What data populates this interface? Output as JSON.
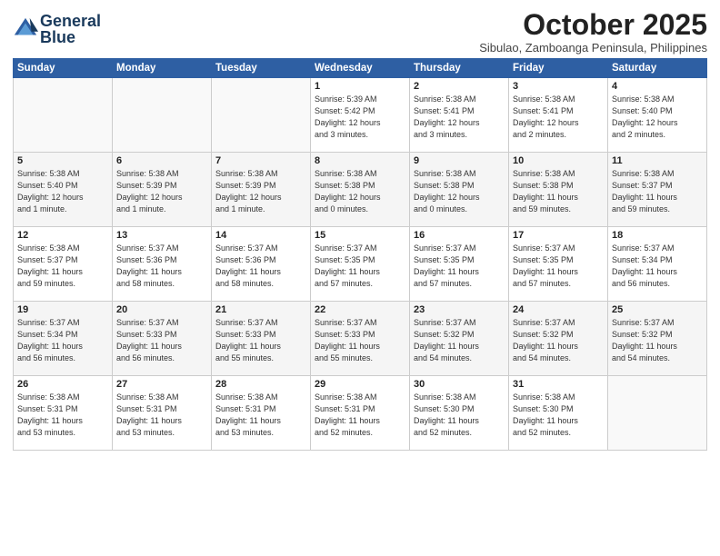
{
  "logo": {
    "line1": "General",
    "line2": "Blue"
  },
  "title": "October 2025",
  "subtitle": "Sibulao, Zamboanga Peninsula, Philippines",
  "days_of_week": [
    "Sunday",
    "Monday",
    "Tuesday",
    "Wednesday",
    "Thursday",
    "Friday",
    "Saturday"
  ],
  "weeks": [
    [
      {
        "day": "",
        "info": ""
      },
      {
        "day": "",
        "info": ""
      },
      {
        "day": "",
        "info": ""
      },
      {
        "day": "1",
        "info": "Sunrise: 5:39 AM\nSunset: 5:42 PM\nDaylight: 12 hours\nand 3 minutes."
      },
      {
        "day": "2",
        "info": "Sunrise: 5:38 AM\nSunset: 5:41 PM\nDaylight: 12 hours\nand 3 minutes."
      },
      {
        "day": "3",
        "info": "Sunrise: 5:38 AM\nSunset: 5:41 PM\nDaylight: 12 hours\nand 2 minutes."
      },
      {
        "day": "4",
        "info": "Sunrise: 5:38 AM\nSunset: 5:40 PM\nDaylight: 12 hours\nand 2 minutes."
      }
    ],
    [
      {
        "day": "5",
        "info": "Sunrise: 5:38 AM\nSunset: 5:40 PM\nDaylight: 12 hours\nand 1 minute."
      },
      {
        "day": "6",
        "info": "Sunrise: 5:38 AM\nSunset: 5:39 PM\nDaylight: 12 hours\nand 1 minute."
      },
      {
        "day": "7",
        "info": "Sunrise: 5:38 AM\nSunset: 5:39 PM\nDaylight: 12 hours\nand 1 minute."
      },
      {
        "day": "8",
        "info": "Sunrise: 5:38 AM\nSunset: 5:38 PM\nDaylight: 12 hours\nand 0 minutes."
      },
      {
        "day": "9",
        "info": "Sunrise: 5:38 AM\nSunset: 5:38 PM\nDaylight: 12 hours\nand 0 minutes."
      },
      {
        "day": "10",
        "info": "Sunrise: 5:38 AM\nSunset: 5:38 PM\nDaylight: 11 hours\nand 59 minutes."
      },
      {
        "day": "11",
        "info": "Sunrise: 5:38 AM\nSunset: 5:37 PM\nDaylight: 11 hours\nand 59 minutes."
      }
    ],
    [
      {
        "day": "12",
        "info": "Sunrise: 5:38 AM\nSunset: 5:37 PM\nDaylight: 11 hours\nand 59 minutes."
      },
      {
        "day": "13",
        "info": "Sunrise: 5:37 AM\nSunset: 5:36 PM\nDaylight: 11 hours\nand 58 minutes."
      },
      {
        "day": "14",
        "info": "Sunrise: 5:37 AM\nSunset: 5:36 PM\nDaylight: 11 hours\nand 58 minutes."
      },
      {
        "day": "15",
        "info": "Sunrise: 5:37 AM\nSunset: 5:35 PM\nDaylight: 11 hours\nand 57 minutes."
      },
      {
        "day": "16",
        "info": "Sunrise: 5:37 AM\nSunset: 5:35 PM\nDaylight: 11 hours\nand 57 minutes."
      },
      {
        "day": "17",
        "info": "Sunrise: 5:37 AM\nSunset: 5:35 PM\nDaylight: 11 hours\nand 57 minutes."
      },
      {
        "day": "18",
        "info": "Sunrise: 5:37 AM\nSunset: 5:34 PM\nDaylight: 11 hours\nand 56 minutes."
      }
    ],
    [
      {
        "day": "19",
        "info": "Sunrise: 5:37 AM\nSunset: 5:34 PM\nDaylight: 11 hours\nand 56 minutes."
      },
      {
        "day": "20",
        "info": "Sunrise: 5:37 AM\nSunset: 5:33 PM\nDaylight: 11 hours\nand 56 minutes."
      },
      {
        "day": "21",
        "info": "Sunrise: 5:37 AM\nSunset: 5:33 PM\nDaylight: 11 hours\nand 55 minutes."
      },
      {
        "day": "22",
        "info": "Sunrise: 5:37 AM\nSunset: 5:33 PM\nDaylight: 11 hours\nand 55 minutes."
      },
      {
        "day": "23",
        "info": "Sunrise: 5:37 AM\nSunset: 5:32 PM\nDaylight: 11 hours\nand 54 minutes."
      },
      {
        "day": "24",
        "info": "Sunrise: 5:37 AM\nSunset: 5:32 PM\nDaylight: 11 hours\nand 54 minutes."
      },
      {
        "day": "25",
        "info": "Sunrise: 5:37 AM\nSunset: 5:32 PM\nDaylight: 11 hours\nand 54 minutes."
      }
    ],
    [
      {
        "day": "26",
        "info": "Sunrise: 5:38 AM\nSunset: 5:31 PM\nDaylight: 11 hours\nand 53 minutes."
      },
      {
        "day": "27",
        "info": "Sunrise: 5:38 AM\nSunset: 5:31 PM\nDaylight: 11 hours\nand 53 minutes."
      },
      {
        "day": "28",
        "info": "Sunrise: 5:38 AM\nSunset: 5:31 PM\nDaylight: 11 hours\nand 53 minutes."
      },
      {
        "day": "29",
        "info": "Sunrise: 5:38 AM\nSunset: 5:31 PM\nDaylight: 11 hours\nand 52 minutes."
      },
      {
        "day": "30",
        "info": "Sunrise: 5:38 AM\nSunset: 5:30 PM\nDaylight: 11 hours\nand 52 minutes."
      },
      {
        "day": "31",
        "info": "Sunrise: 5:38 AM\nSunset: 5:30 PM\nDaylight: 11 hours\nand 52 minutes."
      },
      {
        "day": "",
        "info": ""
      }
    ]
  ]
}
